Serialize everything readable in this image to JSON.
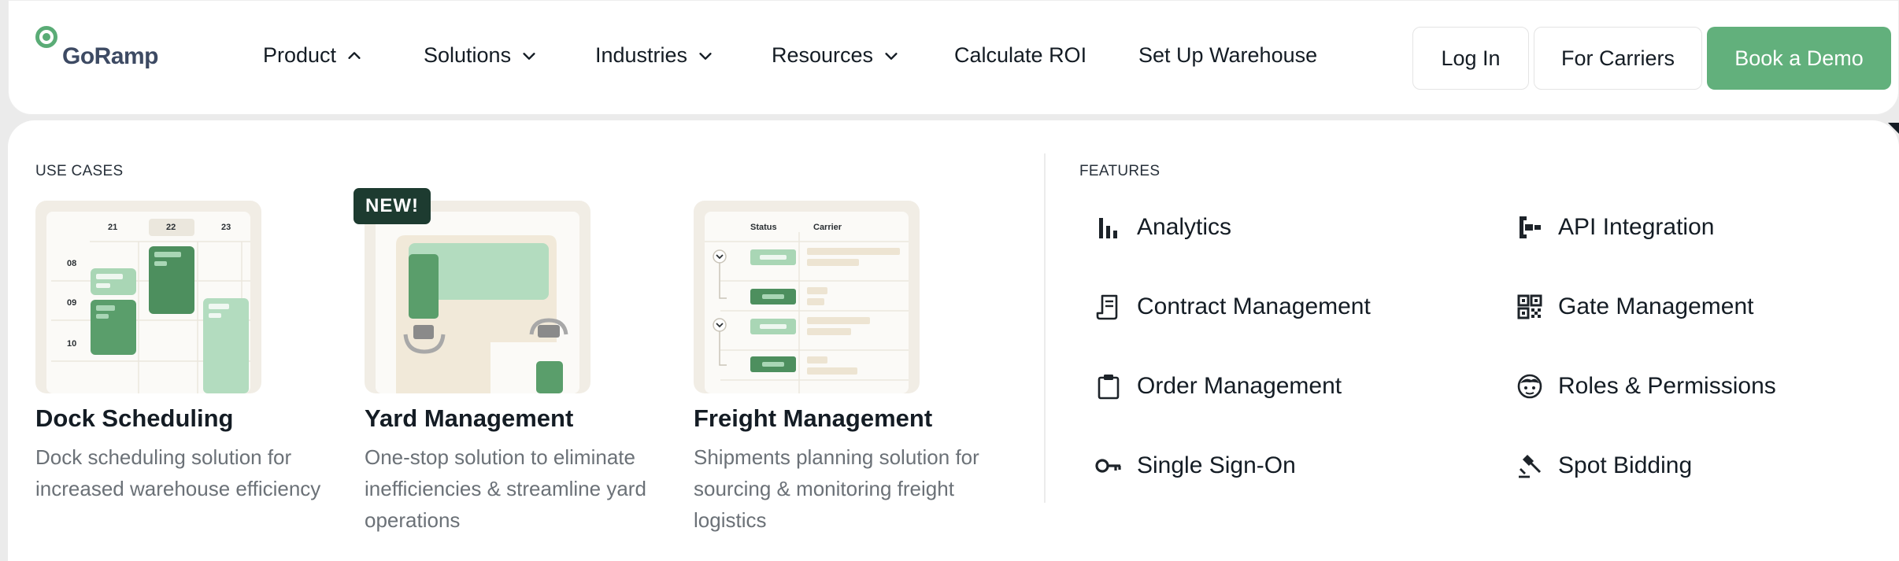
{
  "brand": {
    "name": "GoRamp",
    "color": "#5aac76"
  },
  "nav": {
    "items": [
      {
        "label": "Product",
        "icon": "chevron-up-icon"
      },
      {
        "label": "Solutions",
        "icon": "chevron-down-icon"
      },
      {
        "label": "Industries",
        "icon": "chevron-down-icon"
      },
      {
        "label": "Resources",
        "icon": "chevron-down-icon"
      },
      {
        "label": "Calculate ROI"
      },
      {
        "label": "Set Up Warehouse"
      }
    ],
    "login_label": "Log In",
    "carriers_label": "For Carriers",
    "demo_label": "Book a Demo"
  },
  "menu": {
    "use_cases_heading": "USE CASES",
    "features_heading": "FEATURES",
    "use_cases": [
      {
        "title": "Dock Scheduling",
        "desc": "Dock scheduling solution for increased warehouse efficiency"
      },
      {
        "title": "Yard Management",
        "desc": "One-stop solution to eliminate inefficiencies & streamline yard operations",
        "badge": "NEW!"
      },
      {
        "title": "Freight Management",
        "desc": "Shipments planning solution for sourcing & monitoring freight logistics"
      }
    ],
    "features": [
      {
        "label": "Analytics",
        "icon": "bar-chart-icon"
      },
      {
        "label": "API Integration",
        "icon": "api-integration-icon"
      },
      {
        "label": "Contract Management",
        "icon": "contract-icon"
      },
      {
        "label": "Gate Management",
        "icon": "qr-code-icon"
      },
      {
        "label": "Order Management",
        "icon": "clipboard-icon"
      },
      {
        "label": "Roles & Permissions",
        "icon": "face-icon"
      },
      {
        "label": "Single Sign-On",
        "icon": "key-icon"
      },
      {
        "label": "Spot Bidding",
        "icon": "gavel-icon"
      }
    ]
  },
  "illustrations": {
    "dock": {
      "days": [
        "21",
        "22",
        "23"
      ],
      "hours": [
        "08",
        "09",
        "10"
      ]
    },
    "freight": {
      "col_status": "Status",
      "col_carrier": "Carrier"
    }
  },
  "colors": {
    "primary_button": "#62b07c",
    "badge_bg": "#1d3b30",
    "card_bg": "#f1ede5"
  }
}
